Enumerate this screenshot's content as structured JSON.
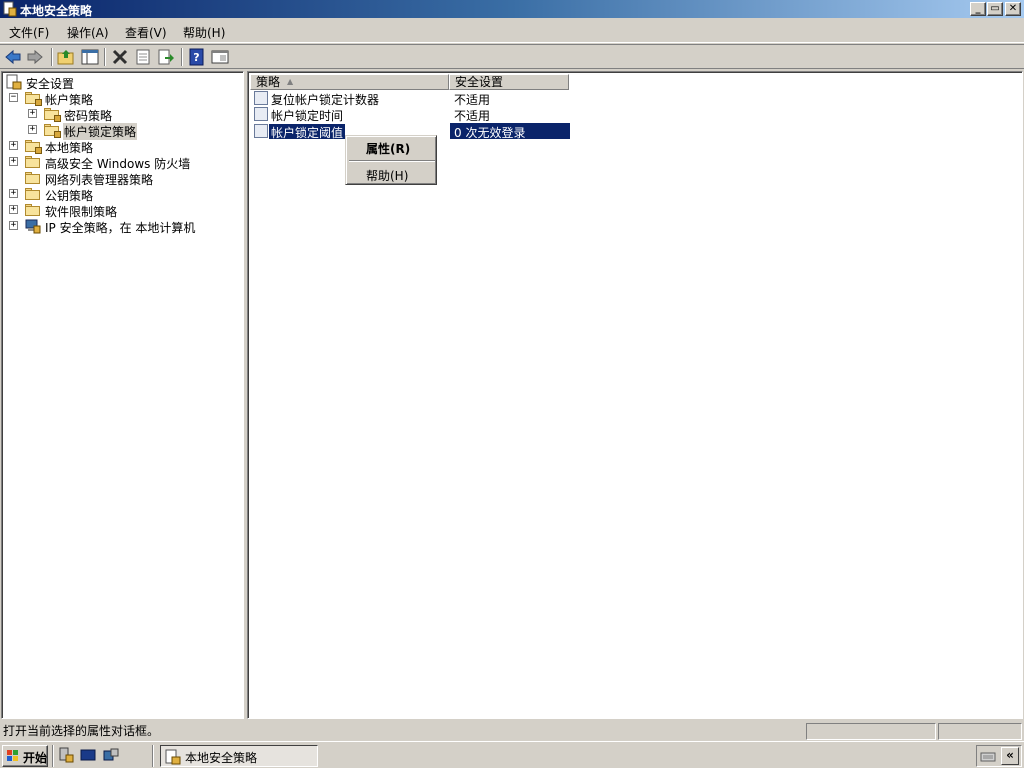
{
  "window": {
    "title": "本地安全策略",
    "minimize": "_",
    "restore": "▭",
    "close": "✕"
  },
  "menu": {
    "file": "文件(F)",
    "action": "操作(A)",
    "view": "查看(V)",
    "help": "帮助(H)"
  },
  "tree": {
    "root": "安全设置",
    "account_policies": "帐户策略",
    "password_policy": "密码策略",
    "lockout_policy": "帐户锁定策略",
    "local_policies": "本地策略",
    "firewall": "高级安全 Windows 防火墙",
    "network_list": "网络列表管理器策略",
    "public_key": "公钥策略",
    "software_restriction": "软件限制策略",
    "ip_security": "IP 安全策略，在 本地计算机"
  },
  "list": {
    "col_policy": "策略",
    "col_setting": "安全设置",
    "rows": [
      {
        "name": "复位帐户锁定计数器",
        "value": "不适用"
      },
      {
        "name": "帐户锁定时间",
        "value": "不适用"
      },
      {
        "name": "帐户锁定阈值",
        "value": "0 次无效登录"
      }
    ]
  },
  "context_menu": {
    "properties": "属性(R)",
    "help": "帮助(H)"
  },
  "status": {
    "text": "打开当前选择的属性对话框。"
  },
  "taskbar": {
    "start": "开始",
    "task_label": "本地安全策略",
    "tray_chevron": "«"
  },
  "colors": {
    "selection": "#0a246a",
    "face": "#d4d0c8"
  }
}
